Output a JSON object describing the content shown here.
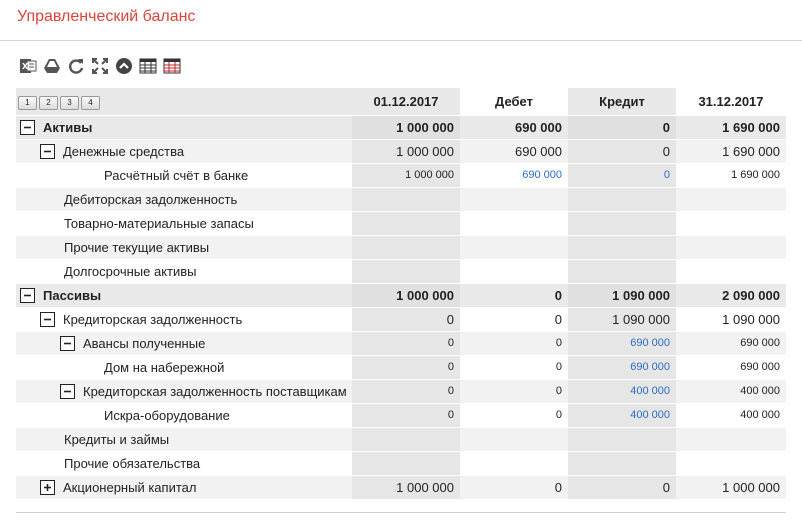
{
  "title": "Управленческий баланс",
  "toolbar": {
    "icons": [
      "excel-export-icon",
      "google-drive-icon",
      "refresh-icon",
      "fullscreen-icon",
      "collapse-up-icon",
      "table-grid-icon",
      "table-grid-red-icon"
    ]
  },
  "levels": [
    "1",
    "2",
    "3",
    "4"
  ],
  "columns": [
    "01.12.2017",
    "Дебет",
    "Кредит",
    "31.12.2017"
  ],
  "rows": [
    {
      "label": "Активы",
      "v": [
        "1 000 000",
        "690 000",
        "0",
        "1 690 000"
      ]
    },
    {
      "label": "Денежные средства",
      "v": [
        "1 000 000",
        "690 000",
        "0",
        "1 690 000"
      ]
    },
    {
      "label": "Расчётный счёт в банке",
      "v": [
        "1 000 000",
        "690 000",
        "0",
        "1 690 000"
      ]
    },
    {
      "label": "Дебиторская задолженность",
      "v": [
        "",
        "",
        "",
        ""
      ]
    },
    {
      "label": "Товарно-материальные запасы",
      "v": [
        "",
        "",
        "",
        ""
      ]
    },
    {
      "label": "Прочие текущие активы",
      "v": [
        "",
        "",
        "",
        ""
      ]
    },
    {
      "label": "Долгосрочные активы",
      "v": [
        "",
        "",
        "",
        ""
      ]
    },
    {
      "label": "Пассивы",
      "v": [
        "1 000 000",
        "0",
        "1 090 000",
        "2 090 000"
      ]
    },
    {
      "label": "Кредиторская задолженность",
      "v": [
        "0",
        "0",
        "1 090 000",
        "1 090 000"
      ]
    },
    {
      "label": "Авансы полученные",
      "v": [
        "0",
        "0",
        "690 000",
        "690 000"
      ]
    },
    {
      "label": "Дом на набережной",
      "v": [
        "0",
        "0",
        "690 000",
        "690 000"
      ]
    },
    {
      "label": "Кредиторская задолженность поставщикам",
      "v": [
        "0",
        "0",
        "400 000",
        "400 000"
      ]
    },
    {
      "label": "Искра-оборудование",
      "v": [
        "0",
        "0",
        "400 000",
        "400 000"
      ]
    },
    {
      "label": "Кредиты и займы",
      "v": [
        "",
        "",
        "",
        ""
      ]
    },
    {
      "label": "Прочие обязательства",
      "v": [
        "",
        "",
        "",
        ""
      ]
    },
    {
      "label": "Акционерный капитал",
      "v": [
        "1 000 000",
        "0",
        "0",
        "1 000 000"
      ]
    }
  ],
  "colors": {
    "title": "#d9453a",
    "link": "#2b6cc4"
  }
}
